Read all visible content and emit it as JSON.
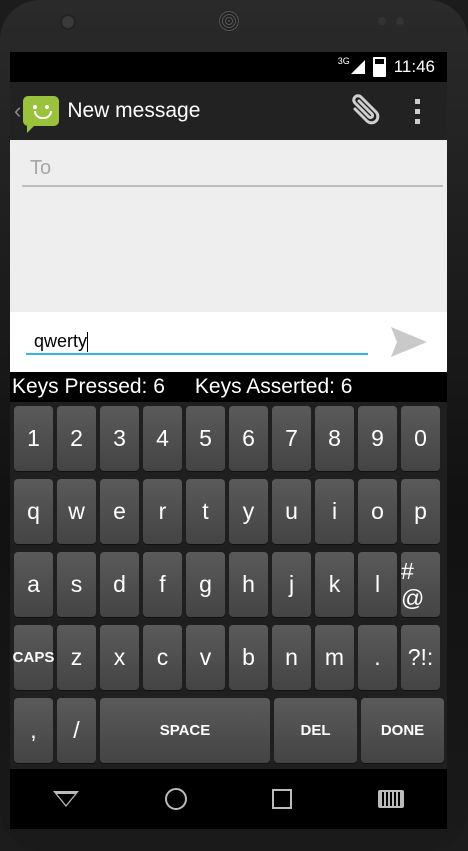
{
  "status": {
    "network": "3G",
    "time": "11:46"
  },
  "actionbar": {
    "title": "New message"
  },
  "compose": {
    "to_placeholder": "To",
    "message_value": "qwerty"
  },
  "counter": {
    "pressed": "Keys Pressed: 6",
    "asserted": "Keys Asserted: 6"
  },
  "keyboard": {
    "row1": [
      "1",
      "2",
      "3",
      "4",
      "5",
      "6",
      "7",
      "8",
      "9",
      "0"
    ],
    "row2": [
      "q",
      "w",
      "e",
      "r",
      "t",
      "y",
      "u",
      "i",
      "o",
      "p"
    ],
    "row3": [
      "a",
      "s",
      "d",
      "f",
      "g",
      "h",
      "j",
      "k",
      "l",
      "# @"
    ],
    "row4": [
      "CAPS",
      "z",
      "x",
      "c",
      "v",
      "b",
      "n",
      "m",
      ".",
      "?!:"
    ],
    "row5": [
      ",",
      "/",
      "SPACE",
      "DEL",
      "DONE"
    ]
  },
  "colors": {
    "accent": "#33b5e5",
    "app_icon": "#9ac23c"
  }
}
